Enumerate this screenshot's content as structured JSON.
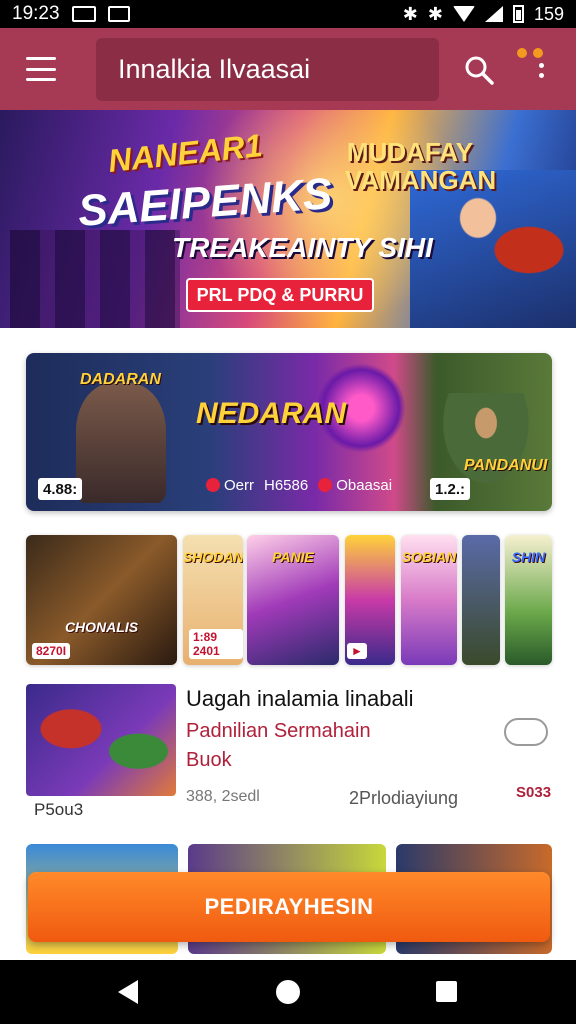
{
  "status_bar": {
    "time": "19:23",
    "battery_text": "159"
  },
  "app_bar": {
    "title": "Innalkia Ilvaasai",
    "accent": "#a63a55"
  },
  "hero": {
    "line1": "NANEAR1",
    "line2": "SAEIPENKS",
    "line3": "TREAKEAINTY SIHI",
    "right_title": "MUDAFAY VAMANGAN",
    "cta_label": "PRL PDQ & PURRU"
  },
  "featured": {
    "title": "NEDARAN",
    "sub_left": "DADARAN",
    "sub_right": "PANDANUI",
    "badge_left": "4.88:",
    "badge_right": "1.2.:",
    "info1": "Oerr",
    "info2": "H6586",
    "info3": "Obaasai"
  },
  "thumbnails": [
    {
      "title": "CHONALIS",
      "price": "8270I"
    },
    {
      "title": "SHODAN",
      "price": "1:89 2401"
    },
    {
      "title": "PANIE",
      "price": ""
    },
    {
      "title": "",
      "price": ""
    },
    {
      "title": "SOBIAN",
      "price": ""
    },
    {
      "title": "",
      "price": ""
    },
    {
      "title": "SHIN",
      "price": ""
    }
  ],
  "list_item": {
    "title": "Uagah  inalamia linabali",
    "subtitle1": "Padnilian Sermahain",
    "subtitle2": "Buok",
    "meta_left": "P5ou3",
    "meta1": "388, 2sedl",
    "meta2": "2Prlodiayiung",
    "price": "S033"
  },
  "cta": {
    "label": "PEDIRAYHESIN"
  }
}
